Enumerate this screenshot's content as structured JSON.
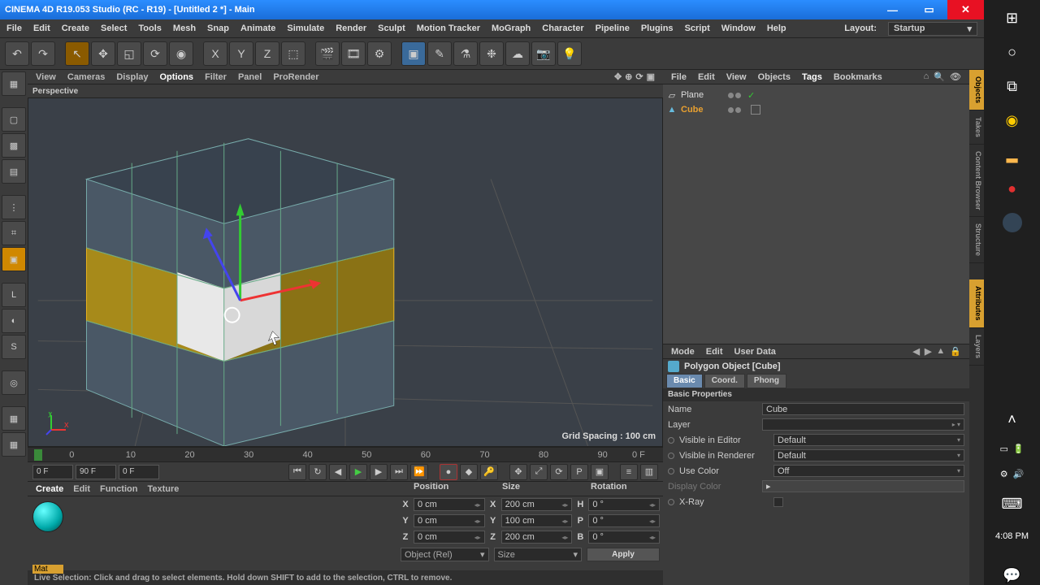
{
  "title": "CINEMA 4D R19.053 Studio (RC - R19) - [Untitled 2 *] - Main",
  "menu": [
    "File",
    "Edit",
    "Create",
    "Select",
    "Tools",
    "Mesh",
    "Snap",
    "Animate",
    "Simulate",
    "Render",
    "Sculpt",
    "Motion Tracker",
    "MoGraph",
    "Character",
    "Pipeline",
    "Plugins",
    "Script",
    "Window",
    "Help"
  ],
  "layout_label": "Layout:",
  "layout_value": "Startup",
  "view_menu": [
    "View",
    "Cameras",
    "Display",
    "Options",
    "Filter",
    "Panel",
    "ProRender"
  ],
  "view_menu_active": "Options",
  "viewport_label": "Perspective",
  "grid_spacing": "Grid Spacing : 100 cm",
  "timeline": {
    "start": "0 F",
    "end": "90 F",
    "cur": "0 F",
    "ticks": [
      "0",
      "10",
      "20",
      "30",
      "40",
      "50",
      "60",
      "70",
      "80",
      "90"
    ],
    "endlab": "0 F"
  },
  "material": {
    "menu": [
      "Create",
      "Edit",
      "Function",
      "Texture"
    ],
    "name": "Mat"
  },
  "coord": {
    "headers": [
      "Position",
      "Size",
      "Rotation"
    ],
    "rows": [
      {
        "axis": "X",
        "pos": "0 cm",
        "size": "200 cm",
        "rotlab": "H",
        "rot": "0 °"
      },
      {
        "axis": "Y",
        "pos": "0 cm",
        "size": "100 cm",
        "rotlab": "P",
        "rot": "0 °"
      },
      {
        "axis": "Z",
        "pos": "0 cm",
        "size": "200 cm",
        "rotlab": "B",
        "rot": "0 °"
      }
    ],
    "mode1": "Object (Rel)",
    "mode2": "Size",
    "apply": "Apply"
  },
  "status": "Live Selection: Click and drag to select elements. Hold down SHIFT to add to the selection, CTRL to remove.",
  "objmgr": {
    "menu": [
      "File",
      "Edit",
      "View",
      "Objects",
      "Tags",
      "Bookmarks"
    ],
    "items": [
      {
        "name": "Plane",
        "sel": false
      },
      {
        "name": "Cube",
        "sel": true
      }
    ]
  },
  "attr": {
    "menu": [
      "Mode",
      "Edit",
      "User Data"
    ],
    "title": "Polygon Object [Cube]",
    "tabs": [
      "Basic",
      "Coord.",
      "Phong"
    ],
    "section": "Basic Properties",
    "props": {
      "name_l": "Name",
      "name_v": "Cube",
      "layer_l": "Layer",
      "vie_l": "Visible in Editor",
      "vie_v": "Default",
      "vir_l": "Visible in Renderer",
      "vir_v": "Default",
      "uc_l": "Use Color",
      "uc_v": "Off",
      "dc_l": "Display Color",
      "xr_l": "X-Ray"
    }
  },
  "rtabs": [
    "Objects",
    "Takes",
    "Content Browser",
    "Structure",
    "Attributes",
    "Layers"
  ],
  "win_time": "4:08 PM"
}
